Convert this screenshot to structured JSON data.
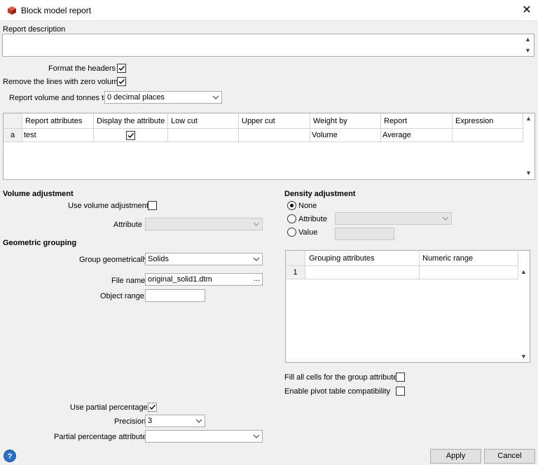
{
  "window": {
    "title": "Block model report",
    "close_glyph": "✕"
  },
  "report_description": {
    "label": "Report description",
    "value": ""
  },
  "options": {
    "format_headers": {
      "label": "Format the headers",
      "checked": true
    },
    "remove_zero_lines": {
      "label": "Remove the lines with zero volume",
      "checked": true
    },
    "report_volume": {
      "label": "Report volume and tonnes to",
      "selected": "0 decimal places"
    }
  },
  "attributes_table": {
    "columns": [
      "Report attributes",
      "Display the attribute",
      "Low cut",
      "Upper cut",
      "Weight by",
      "Report",
      "Expression"
    ],
    "rows": [
      {
        "header": "a",
        "report_attributes": "test",
        "display": true,
        "low_cut": "",
        "upper_cut": "",
        "weight_by": "Volume",
        "report": "Average",
        "expression": ""
      }
    ]
  },
  "volume_adjustment": {
    "heading": "Volume adjustment",
    "use_label": "Use volume adjustment",
    "use_checked": false,
    "attribute_label": "Attribute",
    "attribute_value": ""
  },
  "geometric_grouping": {
    "heading": "Geometric grouping",
    "group_label": "Group geometrically",
    "group_value": "Solids",
    "file_label": "File name",
    "file_value": "original_solid1.dtm",
    "file_browse": "...",
    "object_range_label": "Object range",
    "object_range_value": ""
  },
  "density_adjustment": {
    "heading": "Density adjustment",
    "options": [
      "None",
      "Attribute",
      "Value"
    ],
    "selected": "None",
    "attribute_value": "",
    "value_value": ""
  },
  "grouping_table": {
    "columns": [
      "Grouping attributes",
      "Numeric range"
    ],
    "rows": [
      {
        "header": "1",
        "grouping_attributes": "",
        "numeric_range": ""
      }
    ]
  },
  "group_options": {
    "fill_cells": {
      "label": "Fill all cells for the group attribute",
      "checked": false
    },
    "pivot": {
      "label": "Enable pivot table compatibility",
      "checked": false
    }
  },
  "partial": {
    "use_label": "Use partial percentage",
    "use_checked": true,
    "precision_label": "Precision",
    "precision_value": "3",
    "attribute_label": "Partial percentage attribute",
    "attribute_value": ""
  },
  "buttons": {
    "apply": "Apply",
    "cancel": "Cancel",
    "help": "?"
  },
  "icons": {
    "app": "block-model-icon",
    "checkbox_mark": "check-icon",
    "dropdown": "chevron-down-icon",
    "scroll_up": "scroll-up-arrow-icon",
    "scroll_down": "scroll-down-arrow-icon"
  }
}
